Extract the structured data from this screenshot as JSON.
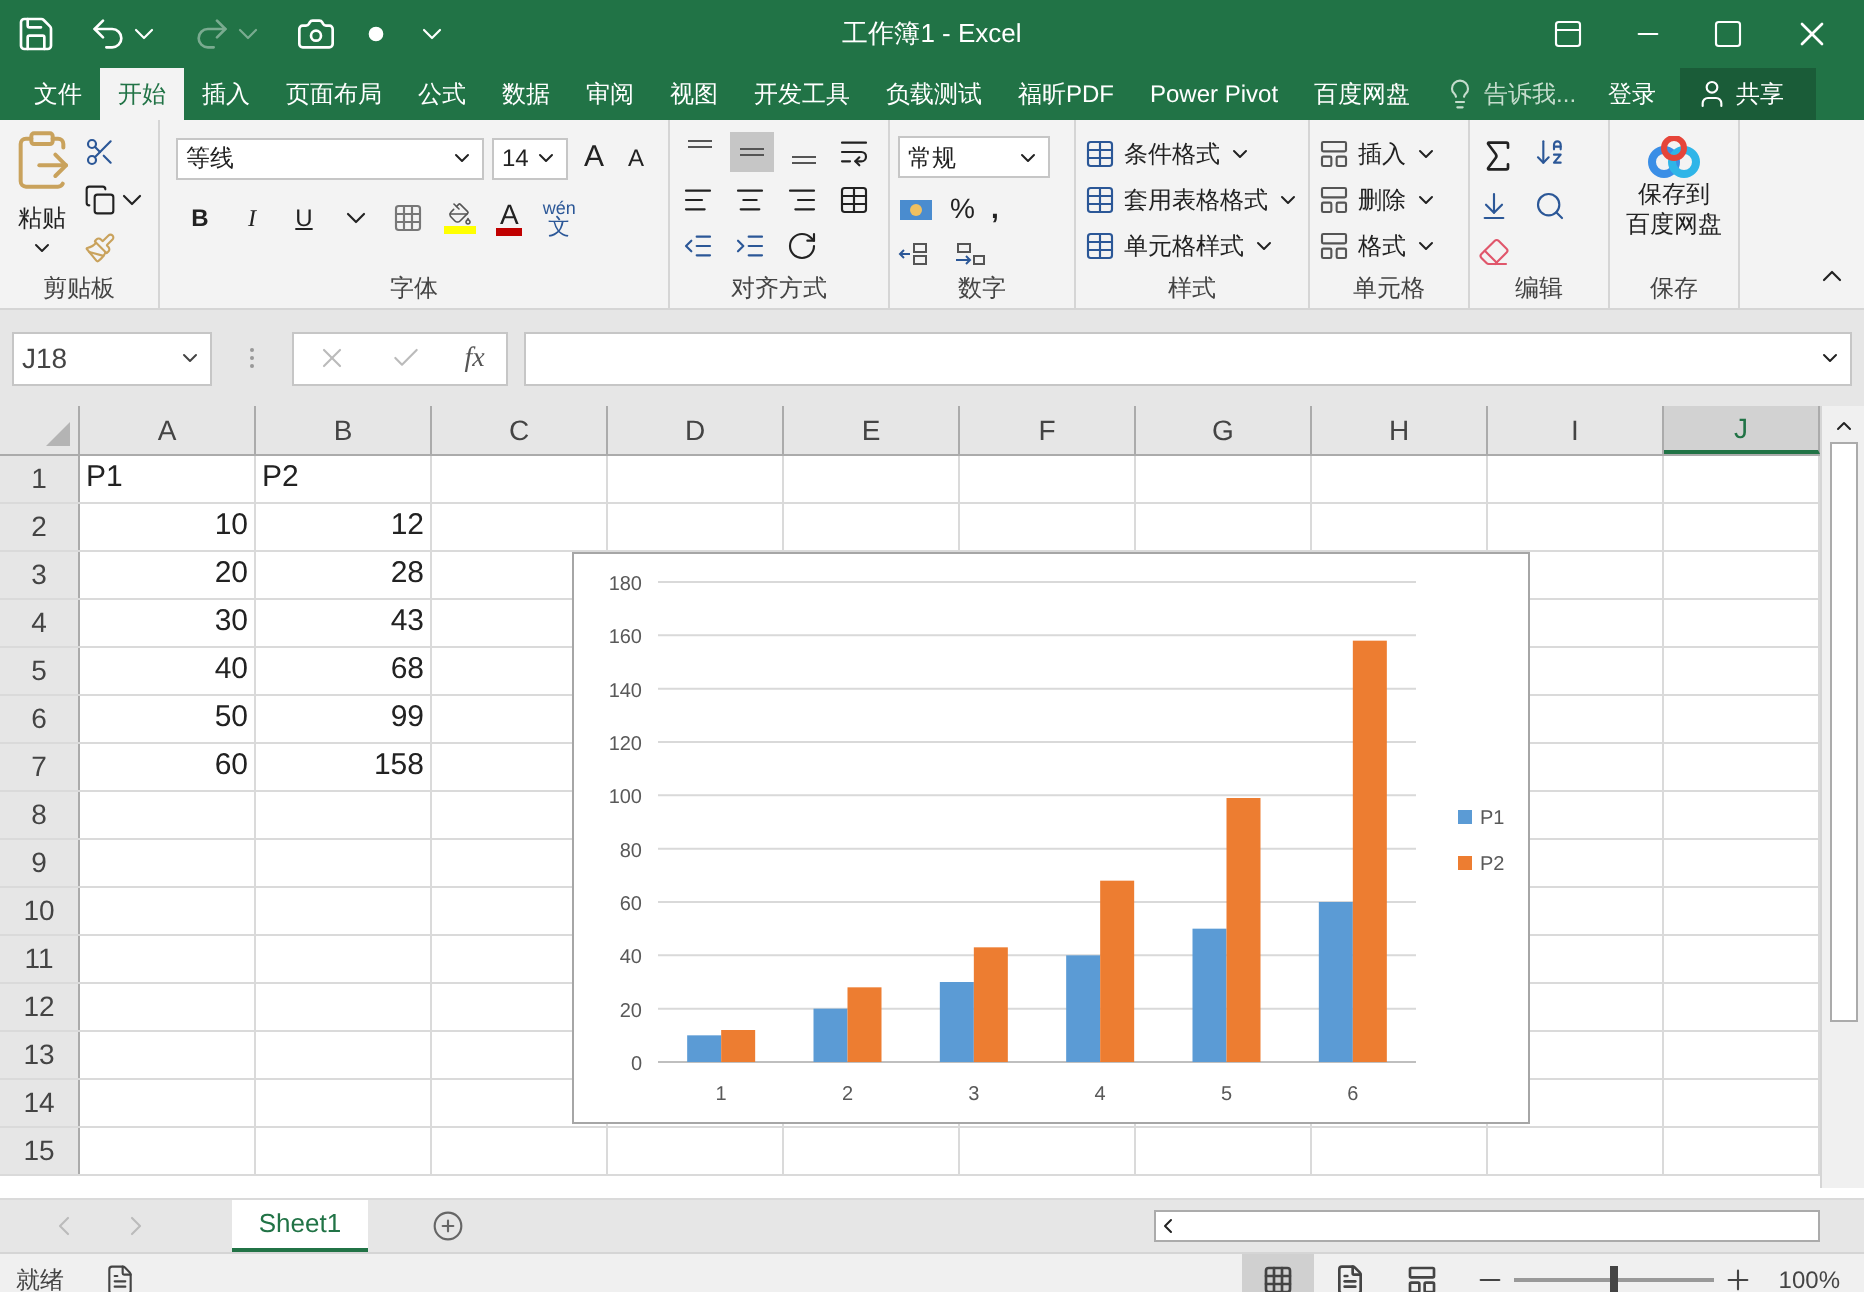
{
  "window": {
    "title": "工作簿1 - Excel"
  },
  "menu_tabs": [
    {
      "label": "文件",
      "selected": false
    },
    {
      "label": "开始",
      "selected": true
    },
    {
      "label": "插入",
      "selected": false
    },
    {
      "label": "页面布局",
      "selected": false
    },
    {
      "label": "公式",
      "selected": false
    },
    {
      "label": "数据",
      "selected": false
    },
    {
      "label": "审阅",
      "selected": false
    },
    {
      "label": "视图",
      "selected": false
    },
    {
      "label": "开发工具",
      "selected": false
    },
    {
      "label": "负载测试",
      "selected": false
    },
    {
      "label": "福昕PDF",
      "selected": false
    },
    {
      "label": "Power Pivot",
      "selected": false
    },
    {
      "label": "百度网盘",
      "selected": false
    }
  ],
  "tell_me": {
    "placeholder": "告诉我..."
  },
  "sign_in": "登录",
  "share": "共享",
  "ribbon": {
    "clipboard": {
      "label": "剪贴板",
      "paste": "粘贴"
    },
    "font": {
      "label": "字体",
      "font_name": "等线",
      "font_size": "14",
      "grow": "A",
      "shrink": "A",
      "styles": [
        "B",
        "I",
        "U"
      ],
      "font_color_letter": "A",
      "phonetic": "wén",
      "phonetic_char": "文"
    },
    "alignment": {
      "label": "对齐方式",
      "vertical": [
        {
          "kind": "top",
          "selected": false
        },
        {
          "kind": "middle",
          "selected": true
        },
        {
          "kind": "bottom",
          "selected": false
        }
      ]
    },
    "number": {
      "label": "数字",
      "format": "常规",
      "percent": "%",
      "comma": ","
    },
    "styles": {
      "label": "样式",
      "items": [
        "条件格式",
        "套用表格格式",
        "单元格样式"
      ]
    },
    "cells": {
      "label": "单元格",
      "items": [
        "插入",
        "删除",
        "格式"
      ]
    },
    "editing": {
      "label": "编辑"
    },
    "save": {
      "label": "保存",
      "button_lines": [
        "保存到",
        "百度网盘"
      ]
    }
  },
  "formula_bar": {
    "name_box": "J18",
    "fx": "fx"
  },
  "sheet": {
    "columns": [
      {
        "label": "A",
        "selected": false
      },
      {
        "label": "B",
        "selected": false
      },
      {
        "label": "C",
        "selected": false
      },
      {
        "label": "D",
        "selected": false
      },
      {
        "label": "E",
        "selected": false
      },
      {
        "label": "F",
        "selected": false
      },
      {
        "label": "G",
        "selected": false
      },
      {
        "label": "H",
        "selected": false
      },
      {
        "label": "I",
        "selected": false
      },
      {
        "label": "J",
        "selected": true
      }
    ],
    "rows": [
      {
        "header": "1",
        "cells": [
          {
            "text": "P1",
            "kind": "text"
          },
          {
            "text": "P2",
            "kind": "text"
          }
        ]
      },
      {
        "header": "2",
        "cells": [
          {
            "text": "10",
            "kind": "number"
          },
          {
            "text": "12",
            "kind": "number"
          }
        ]
      },
      {
        "header": "3",
        "cells": [
          {
            "text": "20",
            "kind": "number"
          },
          {
            "text": "28",
            "kind": "number"
          }
        ]
      },
      {
        "header": "4",
        "cells": [
          {
            "text": "30",
            "kind": "number"
          },
          {
            "text": "43",
            "kind": "number"
          }
        ]
      },
      {
        "header": "5",
        "cells": [
          {
            "text": "40",
            "kind": "number"
          },
          {
            "text": "68",
            "kind": "number"
          }
        ]
      },
      {
        "header": "6",
        "cells": [
          {
            "text": "50",
            "kind": "number"
          },
          {
            "text": "99",
            "kind": "number"
          }
        ]
      },
      {
        "header": "7",
        "cells": [
          {
            "text": "60",
            "kind": "number"
          },
          {
            "text": "158",
            "kind": "number"
          }
        ]
      },
      {
        "header": "8",
        "cells": []
      },
      {
        "header": "9",
        "cells": []
      },
      {
        "header": "10",
        "cells": []
      },
      {
        "header": "11",
        "cells": []
      },
      {
        "header": "12",
        "cells": []
      },
      {
        "header": "13",
        "cells": []
      },
      {
        "header": "14",
        "cells": []
      },
      {
        "header": "15",
        "cells": []
      }
    ]
  },
  "chart": {
    "chart_data": {
      "type": "bar",
      "categories": [
        "1",
        "2",
        "3",
        "4",
        "5",
        "6"
      ],
      "series": [
        {
          "name": "P1",
          "color": "#5b9bd5",
          "values": [
            10,
            20,
            30,
            40,
            50,
            60
          ]
        },
        {
          "name": "P2",
          "color": "#ed7d31",
          "values": [
            12,
            28,
            43,
            68,
            99,
            158
          ]
        }
      ],
      "ylim": [
        0,
        180
      ],
      "yticks": [
        0,
        20,
        40,
        60,
        80,
        100,
        120,
        140,
        160,
        180
      ],
      "grid": true,
      "legend": true
    }
  },
  "sheet_tabs": [
    {
      "label": "Sheet1",
      "selected": true
    }
  ],
  "status_bar": {
    "status": "就绪",
    "zoom": "100%",
    "zoom_slider": {
      "level": 0.5
    }
  }
}
